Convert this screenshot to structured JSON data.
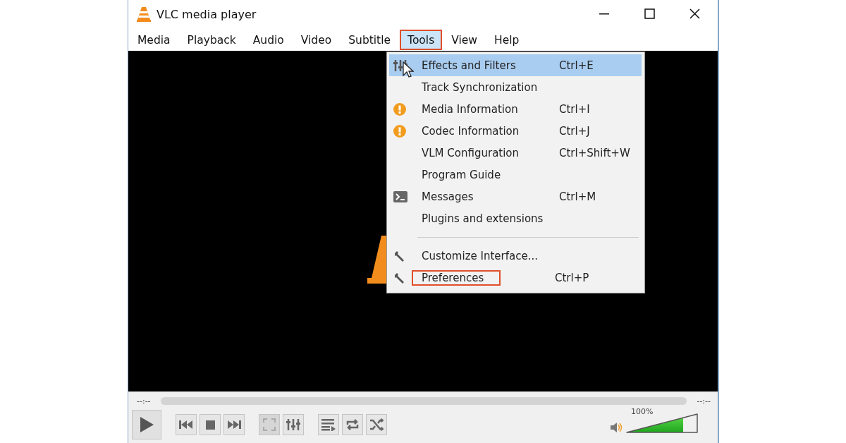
{
  "window": {
    "title": "VLC media player"
  },
  "menu_bar": [
    {
      "label": "Media",
      "selected": false,
      "highlighted": false
    },
    {
      "label": "Playback",
      "selected": false,
      "highlighted": false
    },
    {
      "label": "Audio",
      "selected": false,
      "highlighted": false
    },
    {
      "label": "Video",
      "selected": false,
      "highlighted": false
    },
    {
      "label": "Subtitle",
      "selected": false,
      "highlighted": false
    },
    {
      "label": "Tools",
      "selected": true,
      "highlighted": true
    },
    {
      "label": "View",
      "selected": false,
      "highlighted": false
    },
    {
      "label": "Help",
      "selected": false,
      "highlighted": false
    }
  ],
  "menu": {
    "items": [
      {
        "kind": "effects",
        "label": "Effects and Filters",
        "shortcut": "Ctrl+E",
        "selected": true,
        "highlighted": false
      },
      {
        "kind": "plain",
        "label": "Track Synchronization",
        "selected": false,
        "highlighted": false
      },
      {
        "kind": "info",
        "label": "Media Information",
        "shortcut": "Ctrl+I",
        "selected": false,
        "highlighted": false
      },
      {
        "kind": "info",
        "label": "Codec Information",
        "shortcut": "Ctrl+J",
        "selected": false,
        "highlighted": false
      },
      {
        "kind": "plain",
        "label": "VLM Configuration",
        "shortcut": "Ctrl+Shift+W",
        "selected": false,
        "highlighted": false
      },
      {
        "kind": "plain",
        "label": "Program Guide",
        "selected": false,
        "highlighted": false
      },
      {
        "kind": "console",
        "label": "Messages",
        "shortcut": "Ctrl+M",
        "selected": false,
        "highlighted": false
      },
      {
        "kind": "plain",
        "label": "Plugins and extensions",
        "selected": false,
        "highlighted": false
      },
      {
        "kind": "separator"
      },
      {
        "kind": "tool",
        "label": "Customize Interface...",
        "selected": false,
        "highlighted": false
      },
      {
        "kind": "tool",
        "label": "Preferences",
        "shortcut": "Ctrl+P",
        "selected": false,
        "highlighted": true
      }
    ]
  },
  "player": {
    "elapsed": "--:--",
    "remaining": "--:--",
    "buttons": [
      {
        "kind": "play"
      },
      {
        "kind": "prev"
      },
      {
        "kind": "stop"
      },
      {
        "kind": "next"
      },
      {
        "kind": "fullscreen"
      },
      {
        "kind": "effects"
      },
      {
        "kind": "playlist"
      },
      {
        "kind": "loop"
      },
      {
        "kind": "shuffle"
      }
    ],
    "volume": {
      "reading": "100%",
      "level": 0.8
    }
  }
}
